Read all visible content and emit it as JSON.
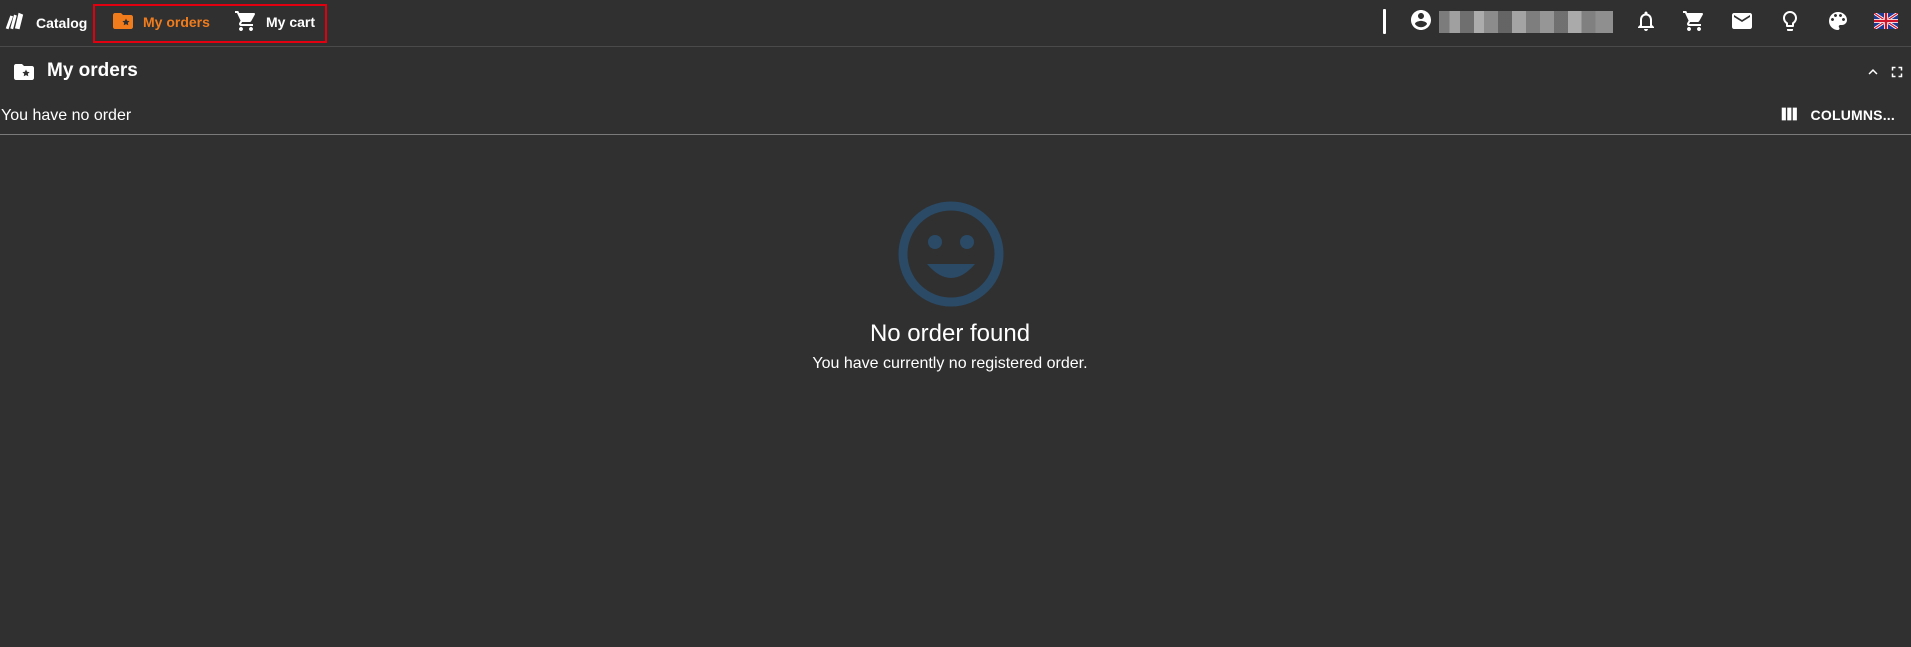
{
  "header": {
    "brand_label": "Catalog",
    "nav": [
      {
        "label": "My orders",
        "icon": "folder-star-icon",
        "active": true
      },
      {
        "label": "My cart",
        "icon": "cart-icon",
        "active": false
      }
    ],
    "user": {
      "icon": "account-circle-icon",
      "name_redacted": true
    },
    "actions": [
      {
        "icon": "bell-icon"
      },
      {
        "icon": "cart-icon"
      },
      {
        "icon": "mail-icon"
      },
      {
        "icon": "lightbulb-icon"
      },
      {
        "icon": "palette-icon"
      },
      {
        "icon": "uk-flag-icon"
      }
    ]
  },
  "panel": {
    "title": "My orders",
    "icon": "folder-star-icon",
    "summary": "You have no order",
    "columns_label": "COLUMNS..."
  },
  "empty_state": {
    "icon": "smiley-icon",
    "title": "No order found",
    "subtitle": "You have currently no registered order."
  },
  "colors": {
    "background": "#303030",
    "accent": "#f07c1c",
    "highlight_border": "#e00010",
    "empty_icon": "#2a4a66"
  }
}
